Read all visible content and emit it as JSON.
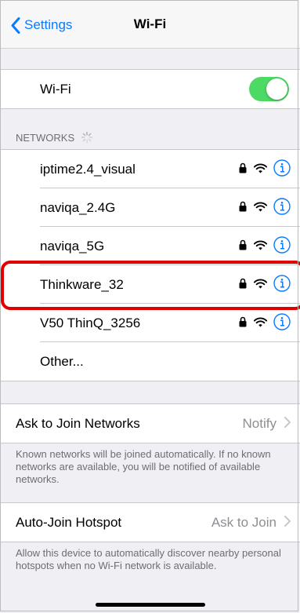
{
  "nav": {
    "back_label": "Settings",
    "title": "Wi-Fi"
  },
  "wifi_toggle": {
    "label": "Wi-Fi",
    "on": true,
    "color": "#4cd964"
  },
  "networks_header": "NETWORKS",
  "networks": [
    {
      "name": "iptime2.4_visual",
      "locked": true,
      "info": true
    },
    {
      "name": "naviqa_2.4G",
      "locked": true,
      "info": true
    },
    {
      "name": "naviqa_5G",
      "locked": true,
      "info": true
    },
    {
      "name": "Thinkware_32",
      "locked": true,
      "info": true,
      "highlighted": true
    },
    {
      "name": "V50 ThinQ_3256",
      "locked": true,
      "info": true
    }
  ],
  "other_label": "Other...",
  "ask_to_join": {
    "label": "Ask to Join Networks",
    "value": "Notify",
    "footer": "Known networks will be joined automatically. If no known networks are available, you will be notified of available networks."
  },
  "auto_join": {
    "label": "Auto-Join Hotspot",
    "value": "Ask to Join",
    "footer": "Allow this device to automatically discover nearby personal hotspots when no Wi-Fi network is available."
  },
  "colors": {
    "accent": "#0a7aff",
    "highlight": "#e10000",
    "background": "#efeff4"
  }
}
